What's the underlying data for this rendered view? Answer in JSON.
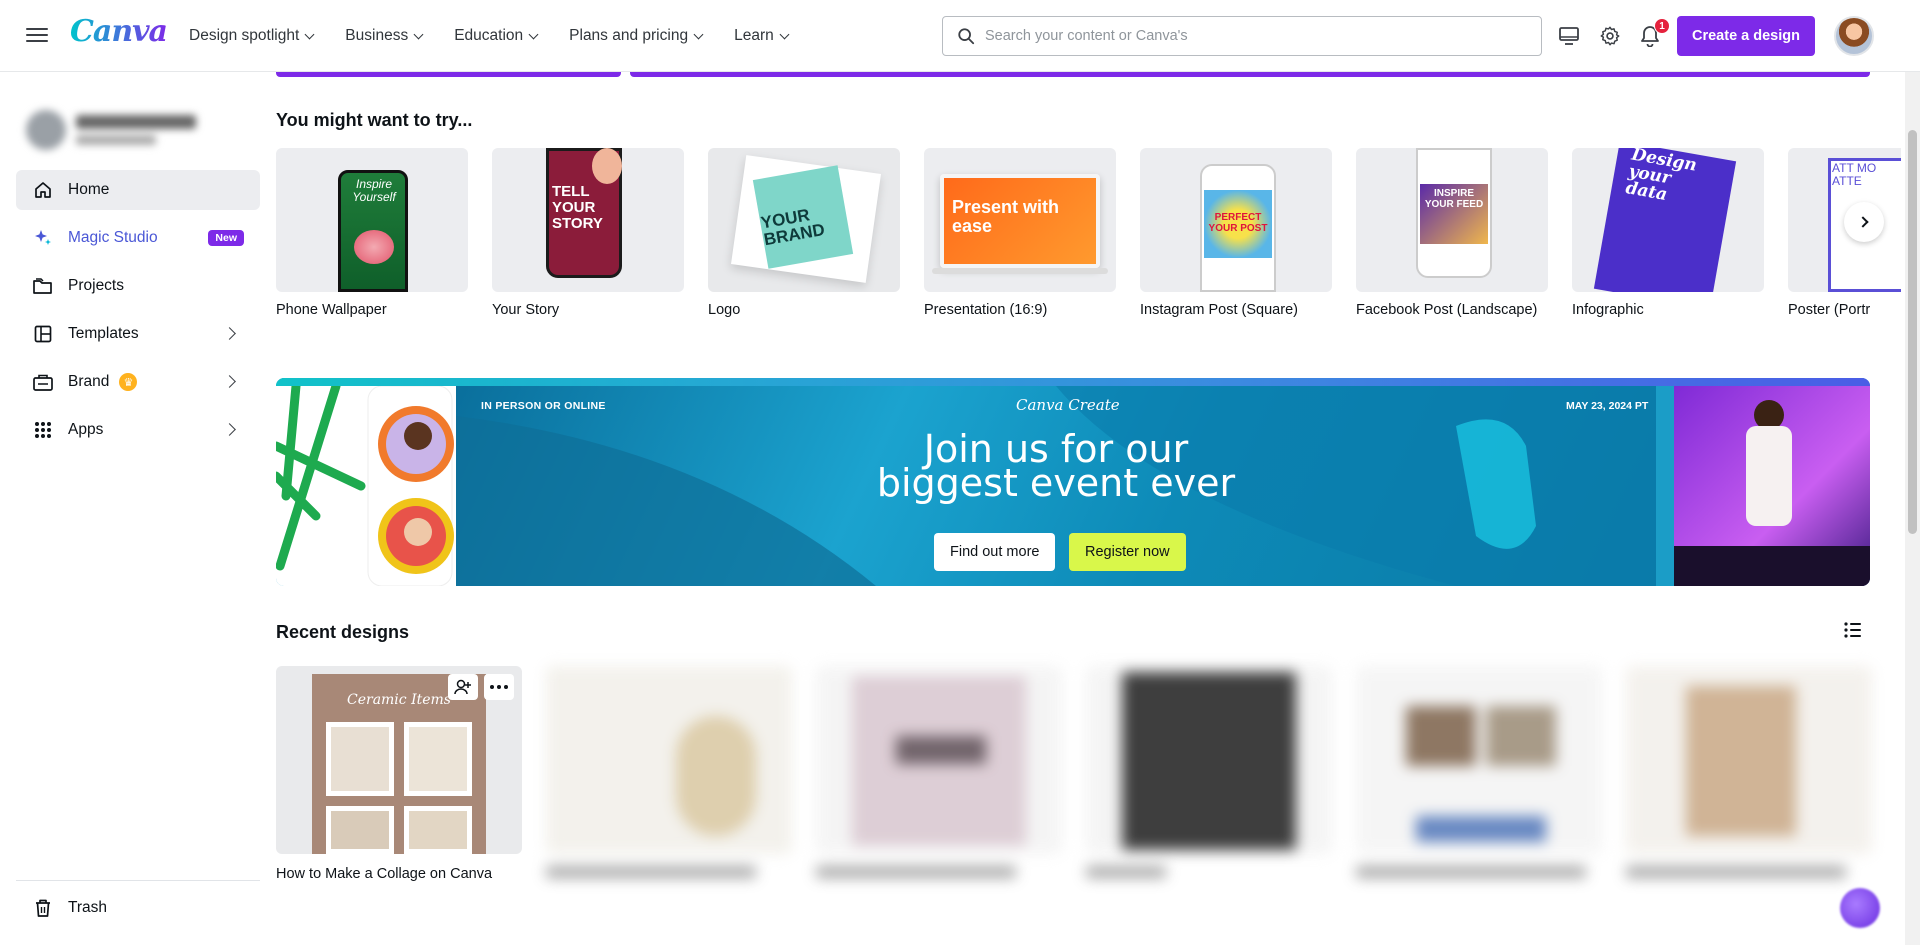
{
  "app": {
    "logo_text": "Canva",
    "accent_color": "#7d2ae8"
  },
  "topnav": {
    "menu": [
      {
        "label": "Design spotlight"
      },
      {
        "label": "Business"
      },
      {
        "label": "Education"
      },
      {
        "label": "Plans and pricing"
      },
      {
        "label": "Learn"
      }
    ],
    "search_placeholder": "Search your content or Canva's",
    "notification_count": "1",
    "create_label": "Create a design"
  },
  "sidebar": {
    "items": [
      {
        "label": "Home",
        "icon": "home-icon",
        "active": true
      },
      {
        "label": "Magic Studio",
        "icon": "sparkle-icon",
        "badge": "New"
      },
      {
        "label": "Projects",
        "icon": "folder-icon"
      },
      {
        "label": "Templates",
        "icon": "templates-icon"
      },
      {
        "label": "Brand",
        "icon": "brand-icon"
      },
      {
        "label": "Apps",
        "icon": "apps-grid-icon"
      }
    ],
    "trash_label": "Trash"
  },
  "main": {
    "try_title": "You might want to try...",
    "try_items": [
      {
        "label": "Phone Wallpaper",
        "thumb_text": "Inspire Yourself"
      },
      {
        "label": "Your Story",
        "thumb_text": "TELL YOUR STORY"
      },
      {
        "label": "Logo",
        "thumb_text": "YOUR BRAND"
      },
      {
        "label": "Presentation (16:9)",
        "thumb_text": "Present with ease"
      },
      {
        "label": "Instagram Post (Square)",
        "thumb_text": "PERFECT YOUR POST"
      },
      {
        "label": "Facebook Post (Landscape)",
        "thumb_text": "INSPIRE YOUR FEED"
      },
      {
        "label": "Infographic",
        "thumb_text": "Design your data"
      },
      {
        "label": "Poster (Portr",
        "thumb_text": "ATT MO ATTE"
      }
    ],
    "banner": {
      "tag": "IN PERSON OR ONLINE",
      "logo": "Canva Create",
      "date": "MAY 23, 2024 PT",
      "headline_line1": "Join us for our",
      "headline_line2": "biggest event ever",
      "find_out_label": "Find out more",
      "register_label": "Register now"
    },
    "recent_title": "Recent designs",
    "recent_items": [
      {
        "title": "How to Make a Collage on Canva",
        "thumb_text": "Ceramic Items"
      },
      {
        "title": "",
        "thumb_text": ""
      },
      {
        "title": "",
        "thumb_text": ""
      },
      {
        "title": "",
        "thumb_text": ""
      },
      {
        "title": "",
        "thumb_text": ""
      },
      {
        "title": "",
        "thumb_text": ""
      }
    ]
  }
}
